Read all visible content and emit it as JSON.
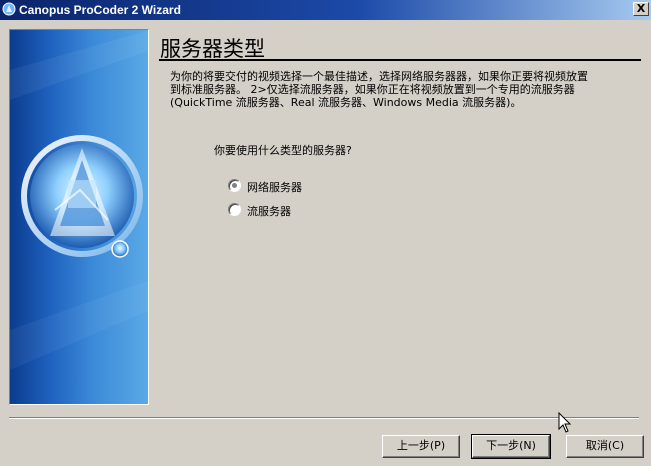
{
  "window": {
    "title": "Canopus ProCoder 2 Wizard",
    "close_label": "X"
  },
  "page": {
    "title": "服务器类型",
    "description_lines": [
      "为你的将要交付的视频选择一个最佳描述，选择网络服务器器，如果你正要将视频放置",
      "到标准服务器。 2>仅选择流服务器，如果你正在将视频放置到一个专用的流服务器",
      "(QuickTime 流服务器、Real 流服务器、Windows Media 流服务器)。"
    ],
    "question": "你要使用什么类型的服务器?",
    "options": [
      {
        "label": "网络服务器",
        "selected": true
      },
      {
        "label": "流服务器",
        "selected": false
      }
    ]
  },
  "buttons": {
    "back": "上一步(P)",
    "next": "下一步(N)",
    "cancel": "取消(C)"
  }
}
